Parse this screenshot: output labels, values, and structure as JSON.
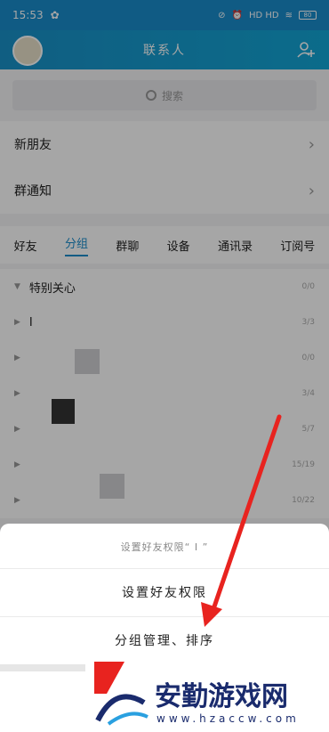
{
  "status": {
    "time": "15:53",
    "indicators": "HD HD",
    "battery": "80"
  },
  "header": {
    "title": "联系人"
  },
  "search": {
    "placeholder": "搜索"
  },
  "rows": [
    {
      "label": "新朋友"
    },
    {
      "label": "群通知"
    }
  ],
  "tabs": [
    "好友",
    "分组",
    "群聊",
    "设备",
    "通讯录",
    "订阅号"
  ],
  "active_tab": "分组",
  "groups": [
    {
      "name": "特别关心",
      "count": "0/0"
    },
    {
      "name": "I",
      "count": "3/3"
    },
    {
      "name": "",
      "count": "0/0"
    },
    {
      "name": "",
      "count": "3/4"
    },
    {
      "name": "",
      "count": "5/7"
    },
    {
      "name": "",
      "count": "15/19"
    },
    {
      "name": "",
      "count": "10/22"
    }
  ],
  "sheet": {
    "title": "设置好友权限“ I ”",
    "items": [
      "设置好友权限",
      "分组管理、排序"
    ]
  },
  "watermark": {
    "text": "安勤游戏网",
    "url": "www.hzaccw.com"
  },
  "colors": {
    "accent": "#1a8ccb",
    "arrow": "#e8231f"
  }
}
